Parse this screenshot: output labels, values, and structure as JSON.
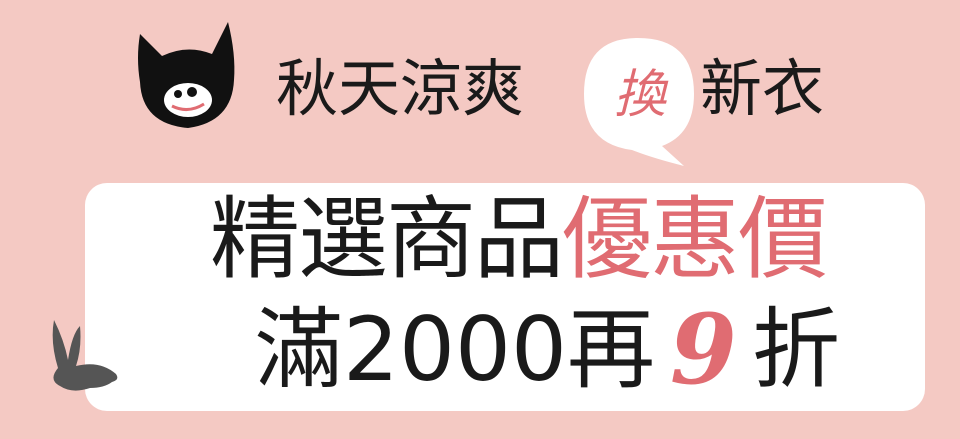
{
  "header": {
    "title_left": "秋天涼爽",
    "bubble_char": "換",
    "title_right": "新衣"
  },
  "promo": {
    "line1_black": "精選商品",
    "line1_pink": "優惠價",
    "line2_prefix": "滿2000再",
    "line2_number": "9",
    "line2_suffix": "折"
  },
  "colors": {
    "background": "#f4c9c3",
    "accent": "#e06c72",
    "text": "#1a1a1a",
    "card": "#ffffff"
  },
  "icons": [
    "cat-logo-icon",
    "speech-bubble-icon",
    "rabbit-icon"
  ]
}
